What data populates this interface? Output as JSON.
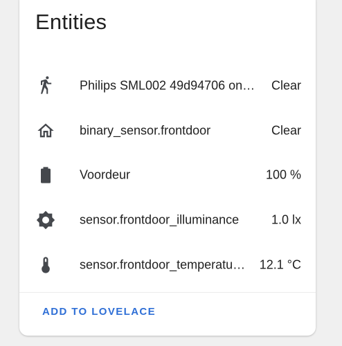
{
  "card": {
    "title": "Entities",
    "action_label": "ADD TO LOVELACE"
  },
  "entities": [
    {
      "icon": "walk-icon",
      "name": "Philips SML002 49d94706 on…",
      "state": "Clear"
    },
    {
      "icon": "home-outline-icon",
      "name": "binary_sensor.frontdoor",
      "state": "Clear"
    },
    {
      "icon": "battery-icon",
      "name": "Voordeur",
      "state": "100 %"
    },
    {
      "icon": "brightness-icon",
      "name": "sensor.frontdoor_illuminance",
      "state": "1.0 lx"
    },
    {
      "icon": "thermometer-icon",
      "name": "sensor.frontdoor_temperatu…",
      "state": "12.1 °C"
    }
  ],
  "colors": {
    "accent": "#2f6fd6",
    "icon": "#44474c",
    "text": "#212121"
  }
}
